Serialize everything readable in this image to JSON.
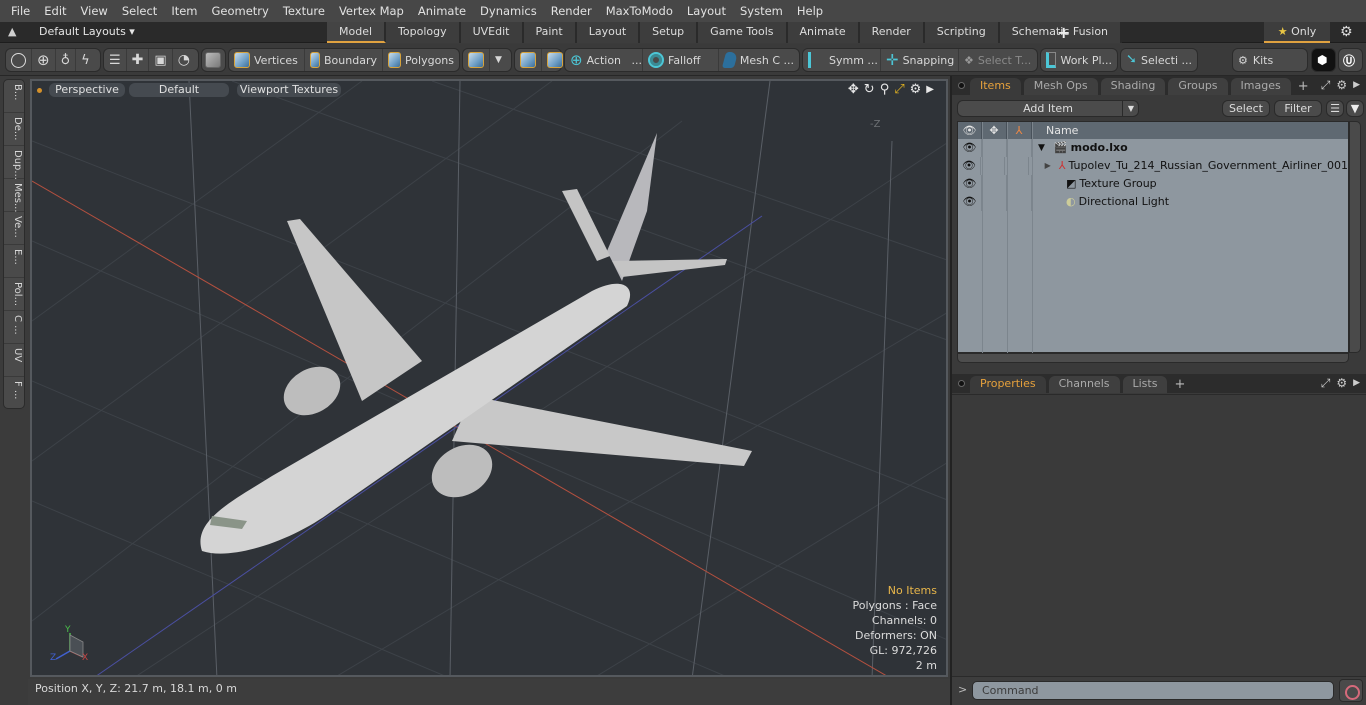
{
  "menubar": {
    "items": [
      "File",
      "Edit",
      "View",
      "Select",
      "Item",
      "Geometry",
      "Texture",
      "Vertex Map",
      "Animate",
      "Dynamics",
      "Render",
      "MaxToModo",
      "Layout",
      "System",
      "Help"
    ]
  },
  "layoutbar": {
    "layout_selector": "Default Layouts ▾",
    "tabs": [
      "Model",
      "Topology",
      "UVEdit",
      "Paint",
      "Layout",
      "Setup",
      "Game Tools",
      "Animate",
      "Render",
      "Scripting",
      "Schematic Fusion"
    ],
    "active_tab": "Model",
    "add_tab": "+",
    "only_label": "Only",
    "star_glyph": "★"
  },
  "toolbar": {
    "vertices": "Vertices",
    "boundary": "Boundary",
    "polygons": "Polygons",
    "action": "Action",
    "action_more": "...",
    "falloff": "Falloff",
    "mesh_c": "Mesh C ...",
    "symm": "Symm ...",
    "snapping": "Snapping",
    "select_t": "Select T...",
    "work_pl": "Work Pl...",
    "selecti": "Selecti ...",
    "kits": "Kits"
  },
  "left_tabs": [
    "B...",
    "De...",
    "Dup...",
    "Mes...",
    "Ve...",
    "E...",
    "Pol...",
    "C ...",
    "UV",
    "F ..."
  ],
  "viewport": {
    "projection": "Perspective",
    "shading": "Default",
    "textures": "Viewport Textures",
    "neg_z_label": "-Z",
    "axis": {
      "x": "X",
      "y": "Y",
      "z": "Z"
    },
    "info": {
      "selection": "No Items",
      "polygons": "Polygons : Face",
      "channels": "Channels: 0",
      "deformers": "Deformers: ON",
      "gl": "GL: 972,726",
      "scale": "2 m"
    },
    "colors": {
      "x_axis": "#b4503f",
      "z_axis": "#4a4fa0",
      "background": "#2f3338"
    }
  },
  "statusbar": {
    "position": "Position X, Y, Z:   21.7 m, 18.1 m, 0 m"
  },
  "items_panel": {
    "tabs": [
      "Items",
      "Mesh Ops",
      "Shading",
      "Groups",
      "Images"
    ],
    "active_tab": "Items",
    "add_item": "Add Item",
    "select": "Select",
    "filter": "Filter",
    "name_header": "Name",
    "tree": [
      {
        "name": "modo.lxo",
        "type": "scene",
        "expanded": true,
        "bold": true
      },
      {
        "name": "Tupolev_Tu_214_Russian_Government_Airliner_001",
        "type": "mesh",
        "expanded": false
      },
      {
        "name": "Texture Group",
        "type": "texture-group"
      },
      {
        "name": "Directional Light",
        "type": "light"
      }
    ]
  },
  "properties_panel": {
    "tabs": [
      "Properties",
      "Channels",
      "Lists"
    ],
    "active_tab": "Properties"
  },
  "command": {
    "prompt": ">",
    "placeholder": "Command"
  },
  "accent_color": "#e0a240"
}
